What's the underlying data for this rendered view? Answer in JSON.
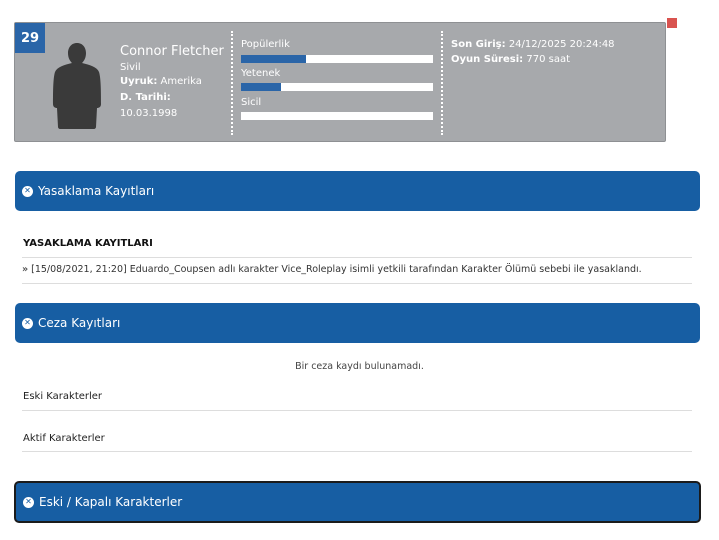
{
  "character": {
    "level": "29",
    "name": "Connor Fletcher",
    "job": "Sivil",
    "nationality_label": "Uyruk:",
    "nationality_value": "Amerika",
    "dob_label": "D. Tarihi:",
    "dob_value": "10.03.1998",
    "stats": [
      {
        "label": "Popülerlik",
        "fill": 0.34
      },
      {
        "label": "Yetenek",
        "fill": 0.21
      },
      {
        "label": "Sicil",
        "fill": 0.0
      }
    ],
    "last_login_label": "Son Giriş:",
    "last_login_value": "24/12/2025 20:24:48",
    "playtime_label": "Oyun Süresi:",
    "playtime_value": "770 saat"
  },
  "sections": {
    "bans": {
      "bar_label": "Yasaklama Kayıtları",
      "heading": "YASAKLAMA KAYITLARI",
      "entries": [
        "[15/08/2021, 21:20] Eduardo_Coupsen adlı karakter Vice_Roleplay isimli yetkili tarafından Karakter Ölümü sebebi ile yasaklandı."
      ]
    },
    "penalties": {
      "bar_label": "Ceza Kayıtları",
      "empty_text": "Bir ceza kaydı bulunamadı."
    },
    "old_characters_label": "Eski Karakterler",
    "active_characters_label": "Aktif Karakterler",
    "closed_characters": {
      "bar_label": "Eski / Kapalı Karakterler"
    }
  },
  "colors": {
    "primary_blue": "#175ea3",
    "card_gray": "#a7a9ac",
    "close_red": "#d9534f"
  }
}
